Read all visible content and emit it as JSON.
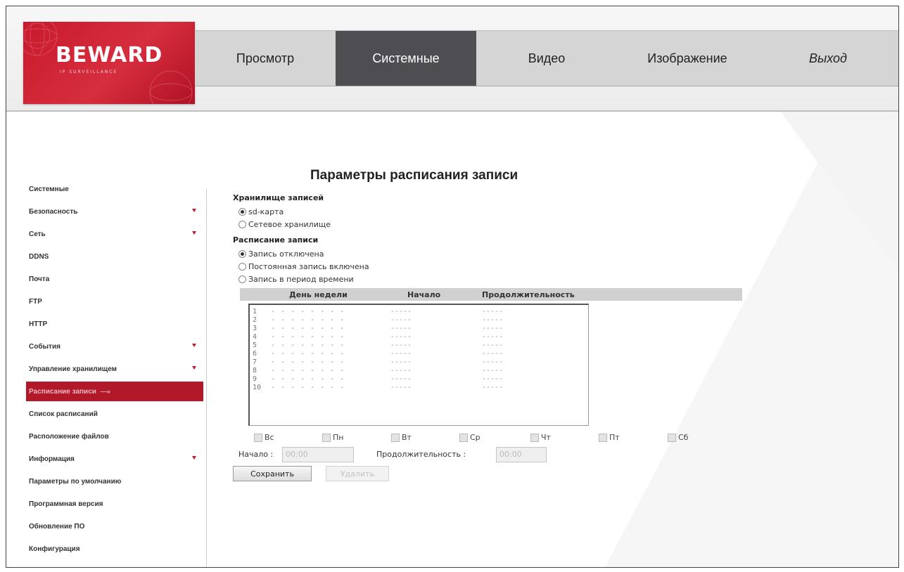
{
  "header": {
    "brand": "BEWARD",
    "brand_sub": "IP SURVEILLANCE",
    "tabs": [
      {
        "label": "Просмотр"
      },
      {
        "label": "Системные"
      },
      {
        "label": "Видео"
      },
      {
        "label": "Изображение"
      },
      {
        "label": "Выход"
      }
    ],
    "active_tab": "Системные"
  },
  "sidebar": {
    "items": [
      {
        "label": "Системные",
        "has_arrow": false
      },
      {
        "label": "Безопасность",
        "has_arrow": true
      },
      {
        "label": "Сеть",
        "has_arrow": true
      },
      {
        "label": "DDNS",
        "has_arrow": false
      },
      {
        "label": "Почта",
        "has_arrow": false
      },
      {
        "label": "FTP",
        "has_arrow": false
      },
      {
        "label": "HTTP",
        "has_arrow": false
      },
      {
        "label": "События",
        "has_arrow": true
      },
      {
        "label": "Управление хранилищем",
        "has_arrow": true
      },
      {
        "label": "Расписание записи",
        "has_arrow": false,
        "active": true,
        "pointer": "—»"
      },
      {
        "label": "Список расписаний",
        "has_arrow": false
      },
      {
        "label": "Расположение файлов",
        "has_arrow": false
      },
      {
        "label": "Информация",
        "has_arrow": true
      },
      {
        "label": "Параметры по умолчанию",
        "has_arrow": false
      },
      {
        "label": "Программная версия",
        "has_arrow": false
      },
      {
        "label": "Обновление ПО",
        "has_arrow": false
      },
      {
        "label": "Конфигурация",
        "has_arrow": false
      }
    ]
  },
  "main": {
    "title": "Параметры расписания записи",
    "storage": {
      "heading": "Хранилище записей",
      "options": [
        {
          "label": "sd-карта",
          "checked": true
        },
        {
          "label": "Сетевое хранилище",
          "checked": false
        }
      ]
    },
    "schedule": {
      "heading": "Расписание записи",
      "options": [
        {
          "label": "Запись отключена",
          "checked": true
        },
        {
          "label": "Постоянная запись включена",
          "checked": false
        },
        {
          "label": "Запись в период времени",
          "checked": false
        }
      ],
      "columns": {
        "day": "День недели",
        "start": "Начало",
        "duration": "Продолжительность"
      },
      "rows": [
        {
          "n": "1",
          "days": "- - - - - - - -",
          "start": "-----",
          "duration": "-----"
        },
        {
          "n": "2",
          "days": "- - - - - - - -",
          "start": "-----",
          "duration": "-----"
        },
        {
          "n": "3",
          "days": "- - - - - - - -",
          "start": "-----",
          "duration": "-----"
        },
        {
          "n": "4",
          "days": "- - - - - - - -",
          "start": "-----",
          "duration": "-----"
        },
        {
          "n": "5",
          "days": "- - - - - - - -",
          "start": "-----",
          "duration": "-----"
        },
        {
          "n": "6",
          "days": "- - - - - - - -",
          "start": "-----",
          "duration": "-----"
        },
        {
          "n": "7",
          "days": "- - - - - - - -",
          "start": "-----",
          "duration": "-----"
        },
        {
          "n": "8",
          "days": "- - - - - - - -",
          "start": "-----",
          "duration": "-----"
        },
        {
          "n": "9",
          "days": "- - - - - - - -",
          "start": "-----",
          "duration": "-----"
        },
        {
          "n": "10",
          "days": "- - - - - - - -",
          "start": "-----",
          "duration": "-----"
        }
      ],
      "days": [
        "Вс",
        "Пн",
        "Вт",
        "Ср",
        "Чт",
        "Пт",
        "Сб"
      ],
      "start_label": "Начало :",
      "start_value": "00:00",
      "duration_label": "Продолжительность :",
      "duration_value": "00:00",
      "save_label": "Сохранить",
      "delete_label": "Удалить"
    }
  },
  "colors": {
    "accent": "#c8192d",
    "active_tab": "#4e4e52",
    "active_side": "#b1192b"
  }
}
